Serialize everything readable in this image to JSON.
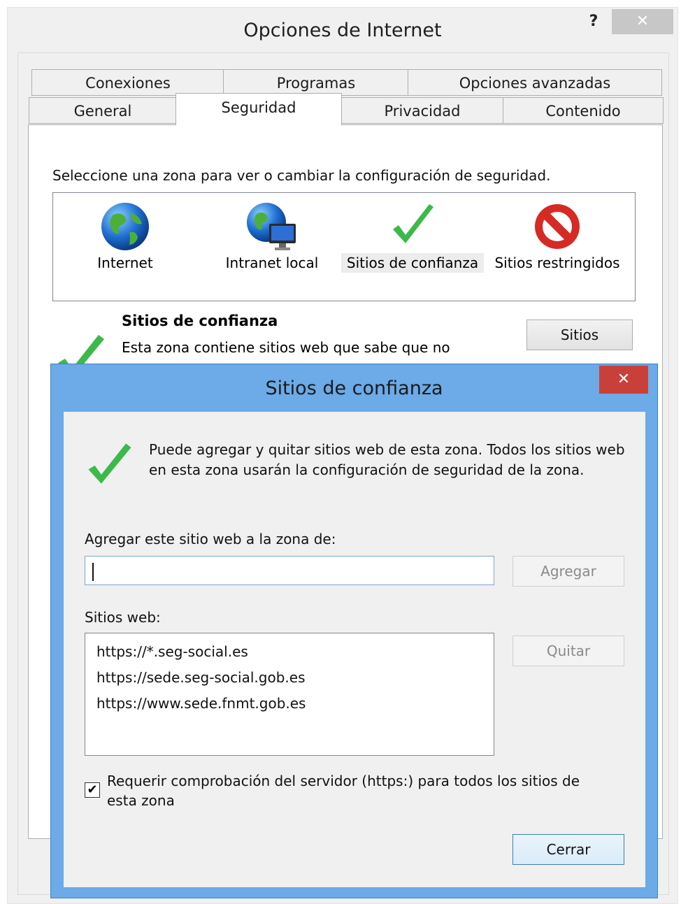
{
  "parent": {
    "title": "Opciones de Internet",
    "help_label": "?",
    "close_label": "✕",
    "tabs_row1": [
      "Conexiones",
      "Programas",
      "Opciones avanzadas"
    ],
    "tabs_row2": [
      "General",
      "Seguridad",
      "Privacidad",
      "Contenido"
    ],
    "active_tab": "Seguridad",
    "instruction": "Seleccione una zona para ver o cambiar la configuración de seguridad.",
    "zones": [
      {
        "label": "Internet",
        "icon": "globe-icon"
      },
      {
        "label": "Intranet local",
        "icon": "globe-monitor-icon"
      },
      {
        "label": "Sitios de confianza",
        "icon": "checkmark-icon",
        "selected": true
      },
      {
        "label": "Sitios restringidos",
        "icon": "no-entry-icon"
      }
    ],
    "zone_info": {
      "title": "Sitios de confianza",
      "description": "Esta zona contiene sitios web que sabe que no",
      "sitios_button": "Sitios"
    }
  },
  "dialog": {
    "title": "Sitios de confianza",
    "close_label": "✕",
    "description": "Puede agregar y quitar sitios web de esta zona. Todos los sitios web en esta zona usarán la configuración de seguridad de la zona.",
    "add_label": "Agregar este sitio web a la zona de:",
    "add_value": "",
    "add_button": "Agregar",
    "list_label": "Sitios web:",
    "sites": [
      "https://*.seg-social.es",
      "https://sede.seg-social.gob.es",
      "https://www.sede.fnmt.gob.es"
    ],
    "remove_button": "Quitar",
    "require_https_label": "Requerir comprobación del servidor (https:) para todos los sitios de esta zona",
    "require_https_checked": true,
    "close_button": "Cerrar"
  },
  "colors": {
    "dialog_frame": "#6caae8",
    "close_red": "#c9403a",
    "check_green": "#3cb94a"
  }
}
